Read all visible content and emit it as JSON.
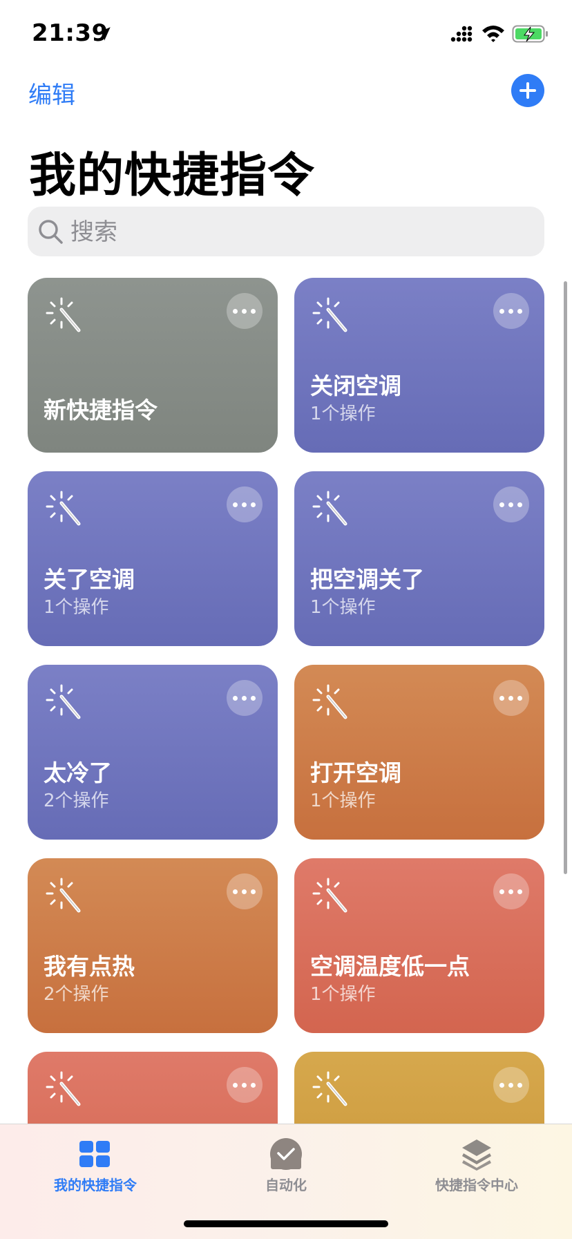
{
  "status_bar": {
    "time": "21:39"
  },
  "nav": {
    "edit_label": "编辑"
  },
  "page": {
    "title": "我的快捷指令"
  },
  "search": {
    "placeholder": "搜索"
  },
  "shortcuts": [
    {
      "name": "新快捷指令",
      "count": "",
      "color": "#8a908a"
    },
    {
      "name": "关闭空调",
      "count": "1个操作",
      "color": "#7076bd"
    },
    {
      "name": "关了空调",
      "count": "1个操作",
      "color": "#7076bd"
    },
    {
      "name": "把空调关了",
      "count": "1个操作",
      "color": "#7076bd"
    },
    {
      "name": "太冷了",
      "count": "2个操作",
      "color": "#7076bd"
    },
    {
      "name": "打开空调",
      "count": "1个操作",
      "color": "#cc7c48"
    },
    {
      "name": "我有点热",
      "count": "2个操作",
      "color": "#cc7c48"
    },
    {
      "name": "空调温度低一点",
      "count": "1个操作",
      "color": "#d96e5b"
    },
    {
      "name": "",
      "count": "",
      "color": "#d96e5b"
    },
    {
      "name": "",
      "count": "",
      "color": "#cf9e42"
    }
  ],
  "tabs": [
    {
      "label": "我的快捷指令",
      "icon": "grid-icon",
      "active": true
    },
    {
      "label": "自动化",
      "icon": "automation-check-icon",
      "active": false
    },
    {
      "label": "快捷指令中心",
      "icon": "layers-icon",
      "active": false
    }
  ],
  "colors": {
    "accent": "#2f7cf6"
  }
}
